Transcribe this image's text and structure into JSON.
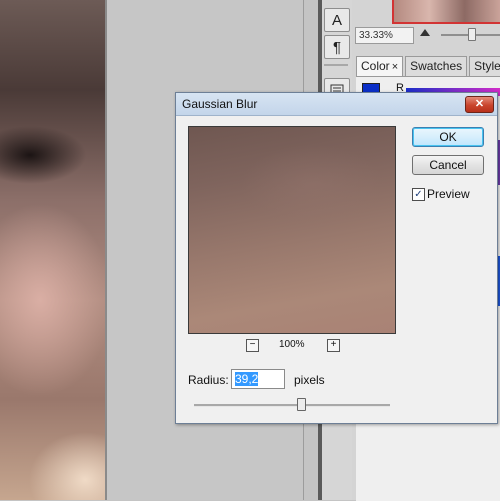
{
  "tools": {
    "type_tool_glyph": "A",
    "paragraph_glyph": "¶",
    "icons": [
      "type-tool-icon",
      "paragraph-icon",
      "character-panel-icon"
    ]
  },
  "navigator": {
    "zoom": "33.33%",
    "accent_color": "#d23434"
  },
  "color_panel": {
    "tabs": [
      {
        "label": "Color",
        "close": "×"
      },
      {
        "label": "Swatches"
      },
      {
        "label": "Style:"
      }
    ],
    "channel_label": "R",
    "foreground_color": "#0b2fc8"
  },
  "dialog": {
    "title": "Gaussian Blur",
    "close_glyph": "✕",
    "ok_label": "OK",
    "cancel_label": "Cancel",
    "preview_label": "Preview",
    "preview_checked": true,
    "preview_zoom": "100%",
    "zoom_out": "−",
    "zoom_in": "+",
    "radius_label": "Radius:",
    "radius_value": "39,2",
    "radius_unit": "pixels",
    "slider_fraction": 0.55
  }
}
